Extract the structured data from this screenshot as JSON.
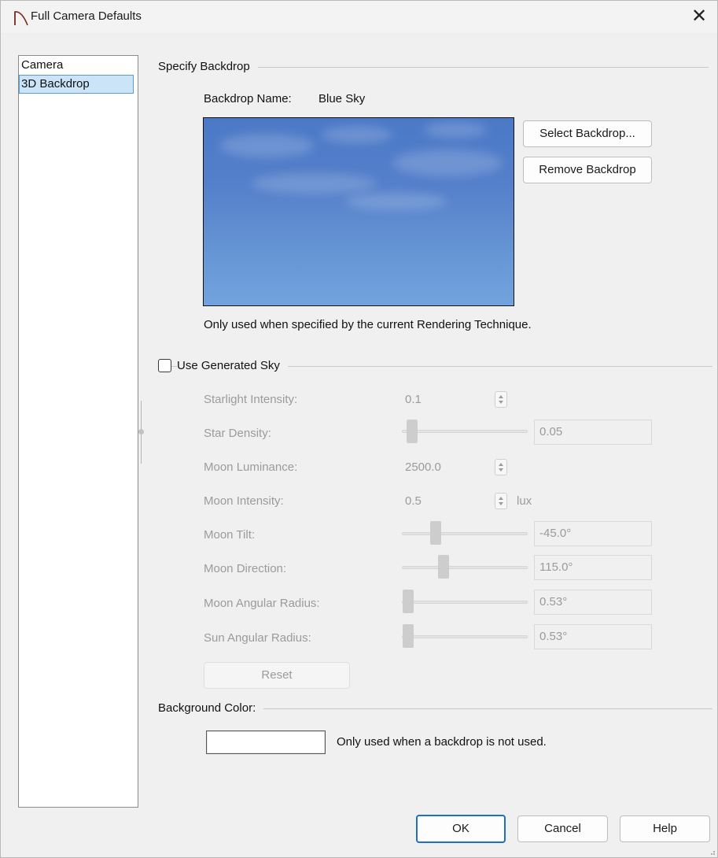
{
  "window": {
    "title": "Full Camera Defaults",
    "close_label": "✕"
  },
  "sidebar": {
    "items": [
      {
        "label": "Camera",
        "selected": false
      },
      {
        "label": "3D Backdrop",
        "selected": true
      }
    ]
  },
  "backdrop": {
    "group_label": "Specify Backdrop",
    "name_label": "Backdrop Name:",
    "name_value": "Blue Sky",
    "select_label": "Select Backdrop...",
    "remove_label": "Remove Backdrop",
    "note": "Only used when specified by the current Rendering Technique."
  },
  "generated_sky": {
    "label": "Use Generated Sky",
    "checked": false,
    "starlight_intensity": {
      "label": "Starlight Intensity:",
      "value": "0.1"
    },
    "star_density": {
      "label": "Star Density:",
      "value": "0.05"
    },
    "moon_luminance": {
      "label": "Moon Luminance:",
      "value": "2500.0"
    },
    "moon_intensity": {
      "label": "Moon Intensity:",
      "value": "0.5",
      "unit": "lux"
    },
    "moon_tilt": {
      "label": "Moon Tilt:",
      "value": "-45.0°"
    },
    "moon_direction": {
      "label": "Moon Direction:",
      "value": "115.0°"
    },
    "moon_angular_radius": {
      "label": "Moon Angular Radius:",
      "value": "0.53°"
    },
    "sun_angular_radius": {
      "label": "Sun Angular Radius:",
      "value": "0.53°"
    },
    "reset_label": "Reset"
  },
  "background": {
    "group_label": "Background Color:",
    "swatch_color": "#ffffff",
    "note": "Only used when a backdrop is not used."
  },
  "footer": {
    "ok_label": "OK",
    "cancel_label": "Cancel",
    "help_label": "Help"
  },
  "colors": {
    "accent": "#1e6fc7",
    "selection": "#cce4f7",
    "disabled_text": "#9b9b9b"
  }
}
